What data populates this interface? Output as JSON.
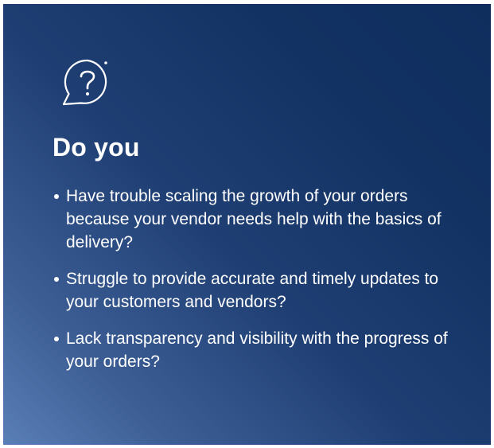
{
  "heading": "Do you",
  "icon": "question-bubble-icon",
  "bullets": [
    "Have trouble scaling the growth of your orders because your vendor needs help with the basics of delivery?",
    "Struggle to provide accurate and timely updates to your customers and vendors?",
    "Lack transparency and visibility with the progress of your orders?"
  ],
  "colors": {
    "gradient_dark": "#0f2e5e",
    "gradient_light": "#5a7eb6",
    "text": "#ffffff"
  }
}
